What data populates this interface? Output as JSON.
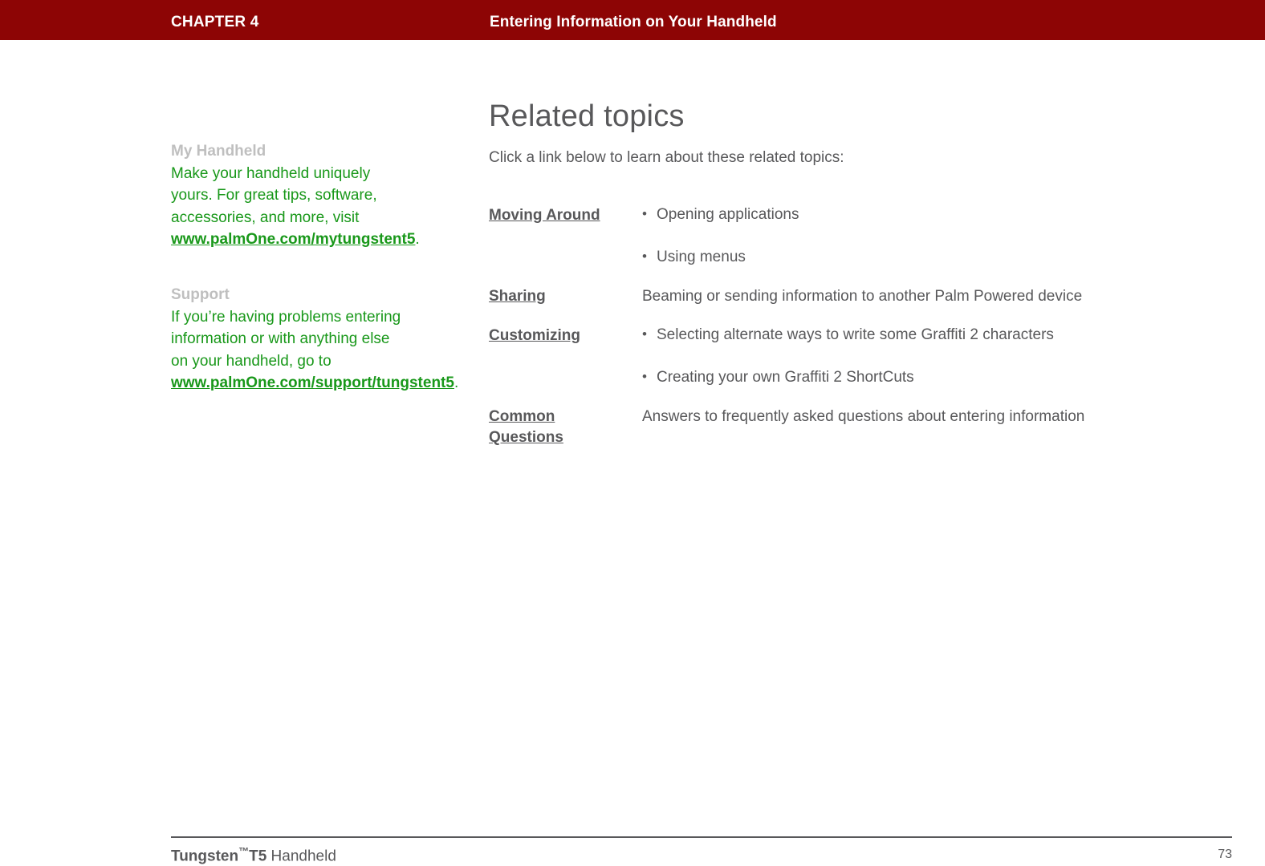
{
  "header": {
    "chapter_label": "CHAPTER 4",
    "chapter_title": "Entering Information on Your Handheld",
    "bar_color": "#8d0505",
    "text_color": "#ffffff"
  },
  "sidebar": {
    "heading_color": "#bfbfbf",
    "text_color": "#19981a",
    "blocks": [
      {
        "heading": "My Handheld",
        "body_before": "Make your handheld uniquely yours. For great tips, software, accessories, and more, visit ",
        "link_line1": "www.palmOne.com/",
        "link_line2": "mytungstent5",
        "body_after": "."
      },
      {
        "heading": "Support",
        "body_before": "If you’re having problems entering information or with anything else on your handheld, go to ",
        "link_line1": "www.palmOne.com/",
        "link_line2": "support/tungstent5",
        "body_after": "."
      }
    ]
  },
  "main": {
    "title": "Related topics",
    "intro": "Click a link below to learn about these related topics:",
    "text_color": "#58585a",
    "topics": [
      {
        "label": "Moving Around",
        "label_lines": [
          "Moving Around"
        ],
        "type": "bullets",
        "items": [
          "Opening applications",
          "Using menus"
        ]
      },
      {
        "label": "Sharing",
        "label_lines": [
          "Sharing"
        ],
        "type": "text",
        "text": "Beaming or sending information to another Palm Powered device"
      },
      {
        "label": "Customizing",
        "label_lines": [
          "Customizing"
        ],
        "type": "bullets",
        "items": [
          "Selecting alternate ways to write some Graffiti 2 characters",
          "Creating your own Graffiti 2 ShortCuts"
        ]
      },
      {
        "label": "Common Questions",
        "label_lines": [
          "Common ",
          "Questions"
        ],
        "type": "text",
        "text": "Answers to frequently asked questions about entering information"
      }
    ]
  },
  "footer": {
    "brand": "Tungsten",
    "tm": "™",
    "model": "T5",
    "kind": " Handheld",
    "page_number": "73",
    "rule_color": "#58585a"
  }
}
